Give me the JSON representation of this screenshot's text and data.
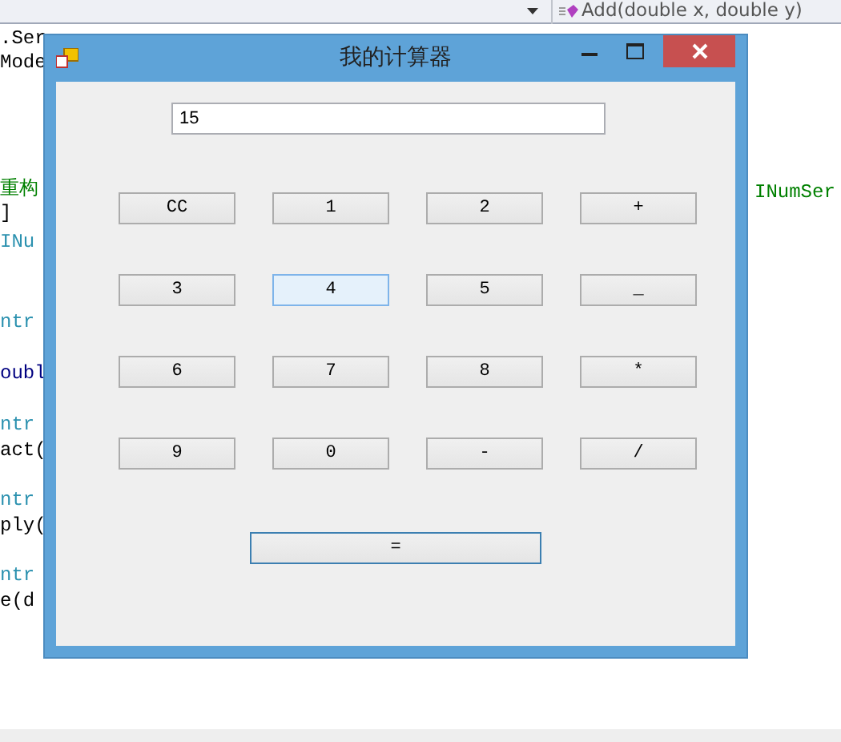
{
  "editor": {
    "member_dropdown": "Add(double x, double y)",
    "code_lines": [
      {
        "text": ".Ser",
        "color": "#000000"
      },
      {
        "text": "Mode",
        "color": "#000000"
      },
      {
        "text": "重构",
        "color": "#008000"
      },
      {
        "text": "]",
        "color": "#000000"
      },
      {
        "text": "INu",
        "color": "#2b91af"
      },
      {
        "text": "ntr",
        "color": "#2b91af"
      },
      {
        "text": "oubl",
        "color": "#000080"
      },
      {
        "text": "ntr",
        "color": "#2b91af"
      },
      {
        "text": "act(",
        "color": "#000000"
      },
      {
        "text": "ntr",
        "color": "#2b91af"
      },
      {
        "text": "ply(",
        "color": "#000000"
      },
      {
        "text": "ntr",
        "color": "#2b91af"
      },
      {
        "text": "e(d",
        "color": "#000000"
      }
    ],
    "right_text": {
      "text": "INumSer",
      "color": "#008000"
    }
  },
  "window": {
    "title": "我的计算器",
    "display": "15",
    "buttons": [
      {
        "label": "CC",
        "hovered": false,
        "focused": false
      },
      {
        "label": "1",
        "hovered": false,
        "focused": false
      },
      {
        "label": "2",
        "hovered": false,
        "focused": false
      },
      {
        "label": "+",
        "hovered": false,
        "focused": false
      },
      {
        "label": "3",
        "hovered": false,
        "focused": false
      },
      {
        "label": "4",
        "hovered": true,
        "focused": false
      },
      {
        "label": "5",
        "hovered": false,
        "focused": false
      },
      {
        "label": "_",
        "hovered": false,
        "focused": false
      },
      {
        "label": "6",
        "hovered": false,
        "focused": false
      },
      {
        "label": "7",
        "hovered": false,
        "focused": false
      },
      {
        "label": "8",
        "hovered": false,
        "focused": false
      },
      {
        "label": "*",
        "hovered": false,
        "focused": false
      },
      {
        "label": "9",
        "hovered": false,
        "focused": false
      },
      {
        "label": "0",
        "hovered": false,
        "focused": false
      },
      {
        "label": "-",
        "hovered": false,
        "focused": false
      },
      {
        "label": "/",
        "hovered": false,
        "focused": false
      }
    ],
    "equals": {
      "label": "=",
      "hovered": false,
      "focused": true
    }
  }
}
